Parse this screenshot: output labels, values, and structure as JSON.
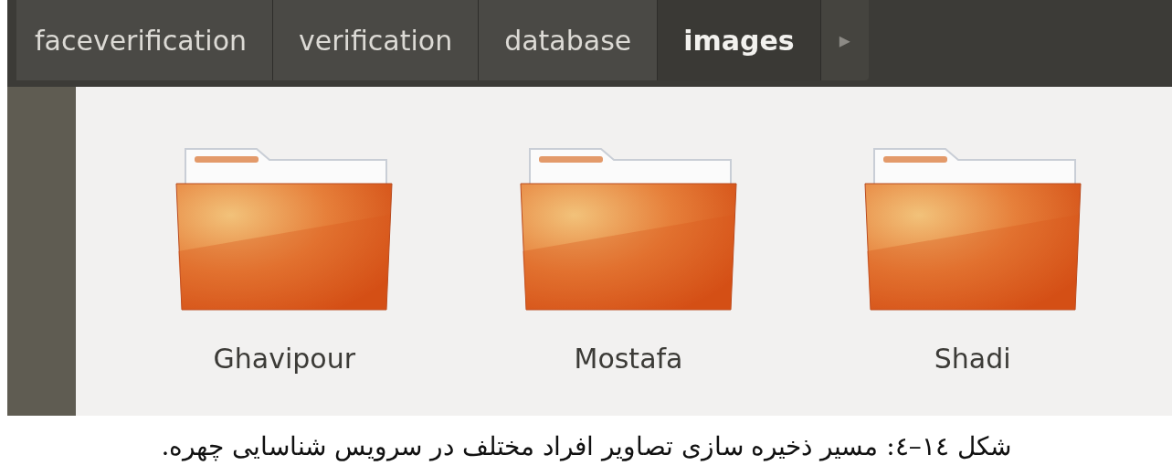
{
  "path_bar": {
    "segments": [
      {
        "label": "faceverification",
        "selected": false
      },
      {
        "label": "verification",
        "selected": false
      },
      {
        "label": "database",
        "selected": false
      },
      {
        "label": "images",
        "selected": true
      }
    ],
    "next_button": "▸"
  },
  "folders": [
    {
      "name": "Ghavipour"
    },
    {
      "name": "Mostafa"
    },
    {
      "name": "Shadi"
    }
  ],
  "caption": "شکل ١٤–٤: مسیر ذخیره سازی تصاویر افراد مختلف در سرویس شناسایی چهره."
}
